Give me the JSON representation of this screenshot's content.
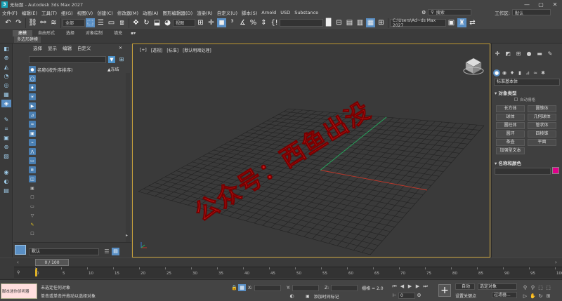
{
  "titlebar": {
    "app_icon": "3",
    "title": "无标题 - Autodesk 3ds Max 2027",
    "minimize": "—",
    "maximize": "▢",
    "close": "✕"
  },
  "menubar": {
    "items": [
      "文件(F)",
      "编辑(E)",
      "工具(T)",
      "组(G)",
      "视图(V)",
      "创建(C)",
      "修改器(M)",
      "动画(A)",
      "图形编辑器(D)",
      "渲染(R)",
      "自定义(U)",
      "脚本(S)",
      "Arnold",
      "USD",
      "Substance"
    ],
    "search_label": "搜索",
    "workspace_label": "工作区:",
    "workspace_value": "默认"
  },
  "toolbar": {
    "selection_filter": "全部",
    "view_dropdown": "视图",
    "path_field": "C:\\Users\\Ad~ds Max 2027"
  },
  "ribbon": {
    "tabs": [
      "建模",
      "自由形式",
      "选择",
      "对象绘制",
      "填充"
    ],
    "active_tab": "建模",
    "sublabel": "多边形建模"
  },
  "explorer": {
    "tabs": [
      "选择",
      "显示",
      "编辑",
      "自定义"
    ],
    "column_name": "名称(按升序排序)",
    "column_frozen": "▲冻结",
    "layer_name": "默认"
  },
  "viewport": {
    "labels": [
      "[+]",
      "[透视]",
      "[标准]",
      "[默认明暗处理]"
    ],
    "watermark": "公众号：西鱼出没"
  },
  "command_panel": {
    "category_dropdown": "标准基本体",
    "rollout_object_type": "对象类型",
    "autogrid": "自动栅格",
    "object_buttons": [
      "长方体",
      "圆锥体",
      "球体",
      "几何球体",
      "圆柱体",
      "管状体",
      "圆环",
      "四棱锥",
      "茶壶",
      "平面",
      "加强型文本"
    ],
    "rollout_name_color": "名称和颜色",
    "color": "#e0008a"
  },
  "timeline": {
    "slider_label": "0 / 100",
    "ticks": [
      0,
      5,
      10,
      15,
      20,
      25,
      30,
      35,
      40,
      45,
      50,
      55,
      60,
      65,
      70,
      75,
      80,
      85,
      90,
      95,
      100
    ]
  },
  "statusbar": {
    "maxscript": "脚本迷你侦听器",
    "status_line1": "未选定任何对象",
    "status_line2": "单击或单击并拖动以选择对象",
    "x_label": "X:",
    "y_label": "Y:",
    "z_label": "Z:",
    "grid_label": "栅格 = 2.0",
    "add_tag": "添加时间标记",
    "auto_key": "自动",
    "selected_dd": "选定对象",
    "set_key": "设置关键点",
    "filters": "过滤器...",
    "frame_value": "0"
  }
}
